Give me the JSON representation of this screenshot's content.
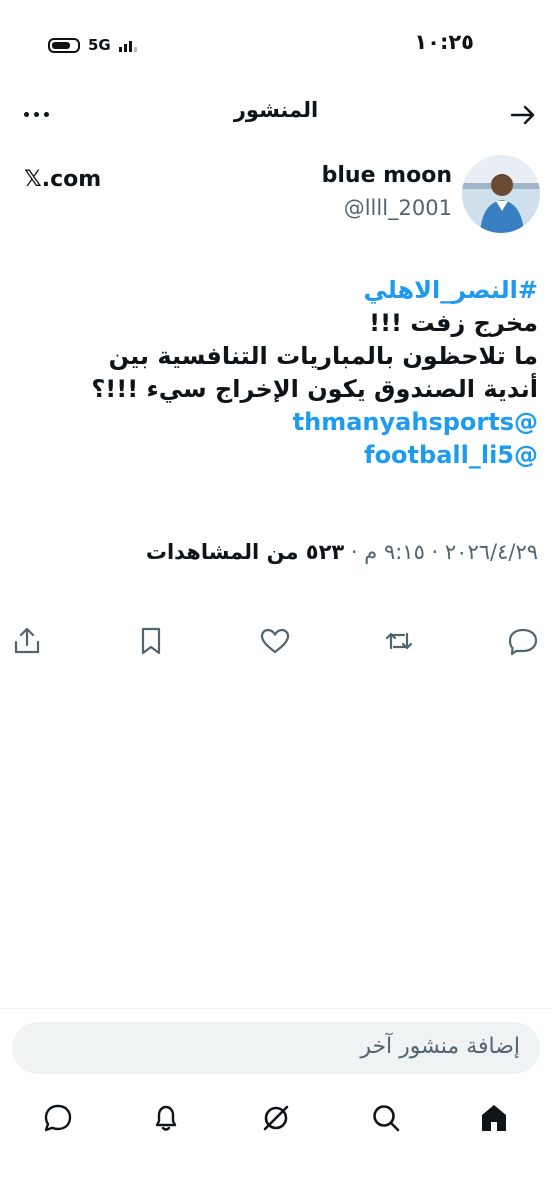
{
  "status_bar": {
    "time": "١٠:٢٥",
    "network": "5G"
  },
  "header": {
    "title": "المنشور"
  },
  "post": {
    "display_name": "blue moon",
    "handle": "@llll_2001",
    "source": "𝕏.com",
    "hashtag": "#النصر_الاهلي",
    "line1": "مخرج زفت !!!",
    "line2": "ما تلاحظون بالمباريات التنافسية بين",
    "line3": "أندية الصندوق يكون الإخراج سيء !!!؟",
    "mention1": "@thmanyahsports",
    "mention2": "@football_li5",
    "date_time": "٢٠٢٦/٤/٢٩ · ٩:١٥ م · ",
    "views_count": "٥٢٣",
    "views_label": " من المشاهدات"
  },
  "actions": [
    "reply-icon",
    "repost-icon",
    "like-icon",
    "bookmark-icon",
    "share-icon"
  ],
  "reply": {
    "placeholder": "إضافة منشور آخر"
  },
  "bottom_nav": [
    "home-icon",
    "search-icon",
    "grok-icon",
    "notifications-icon",
    "messages-icon"
  ]
}
